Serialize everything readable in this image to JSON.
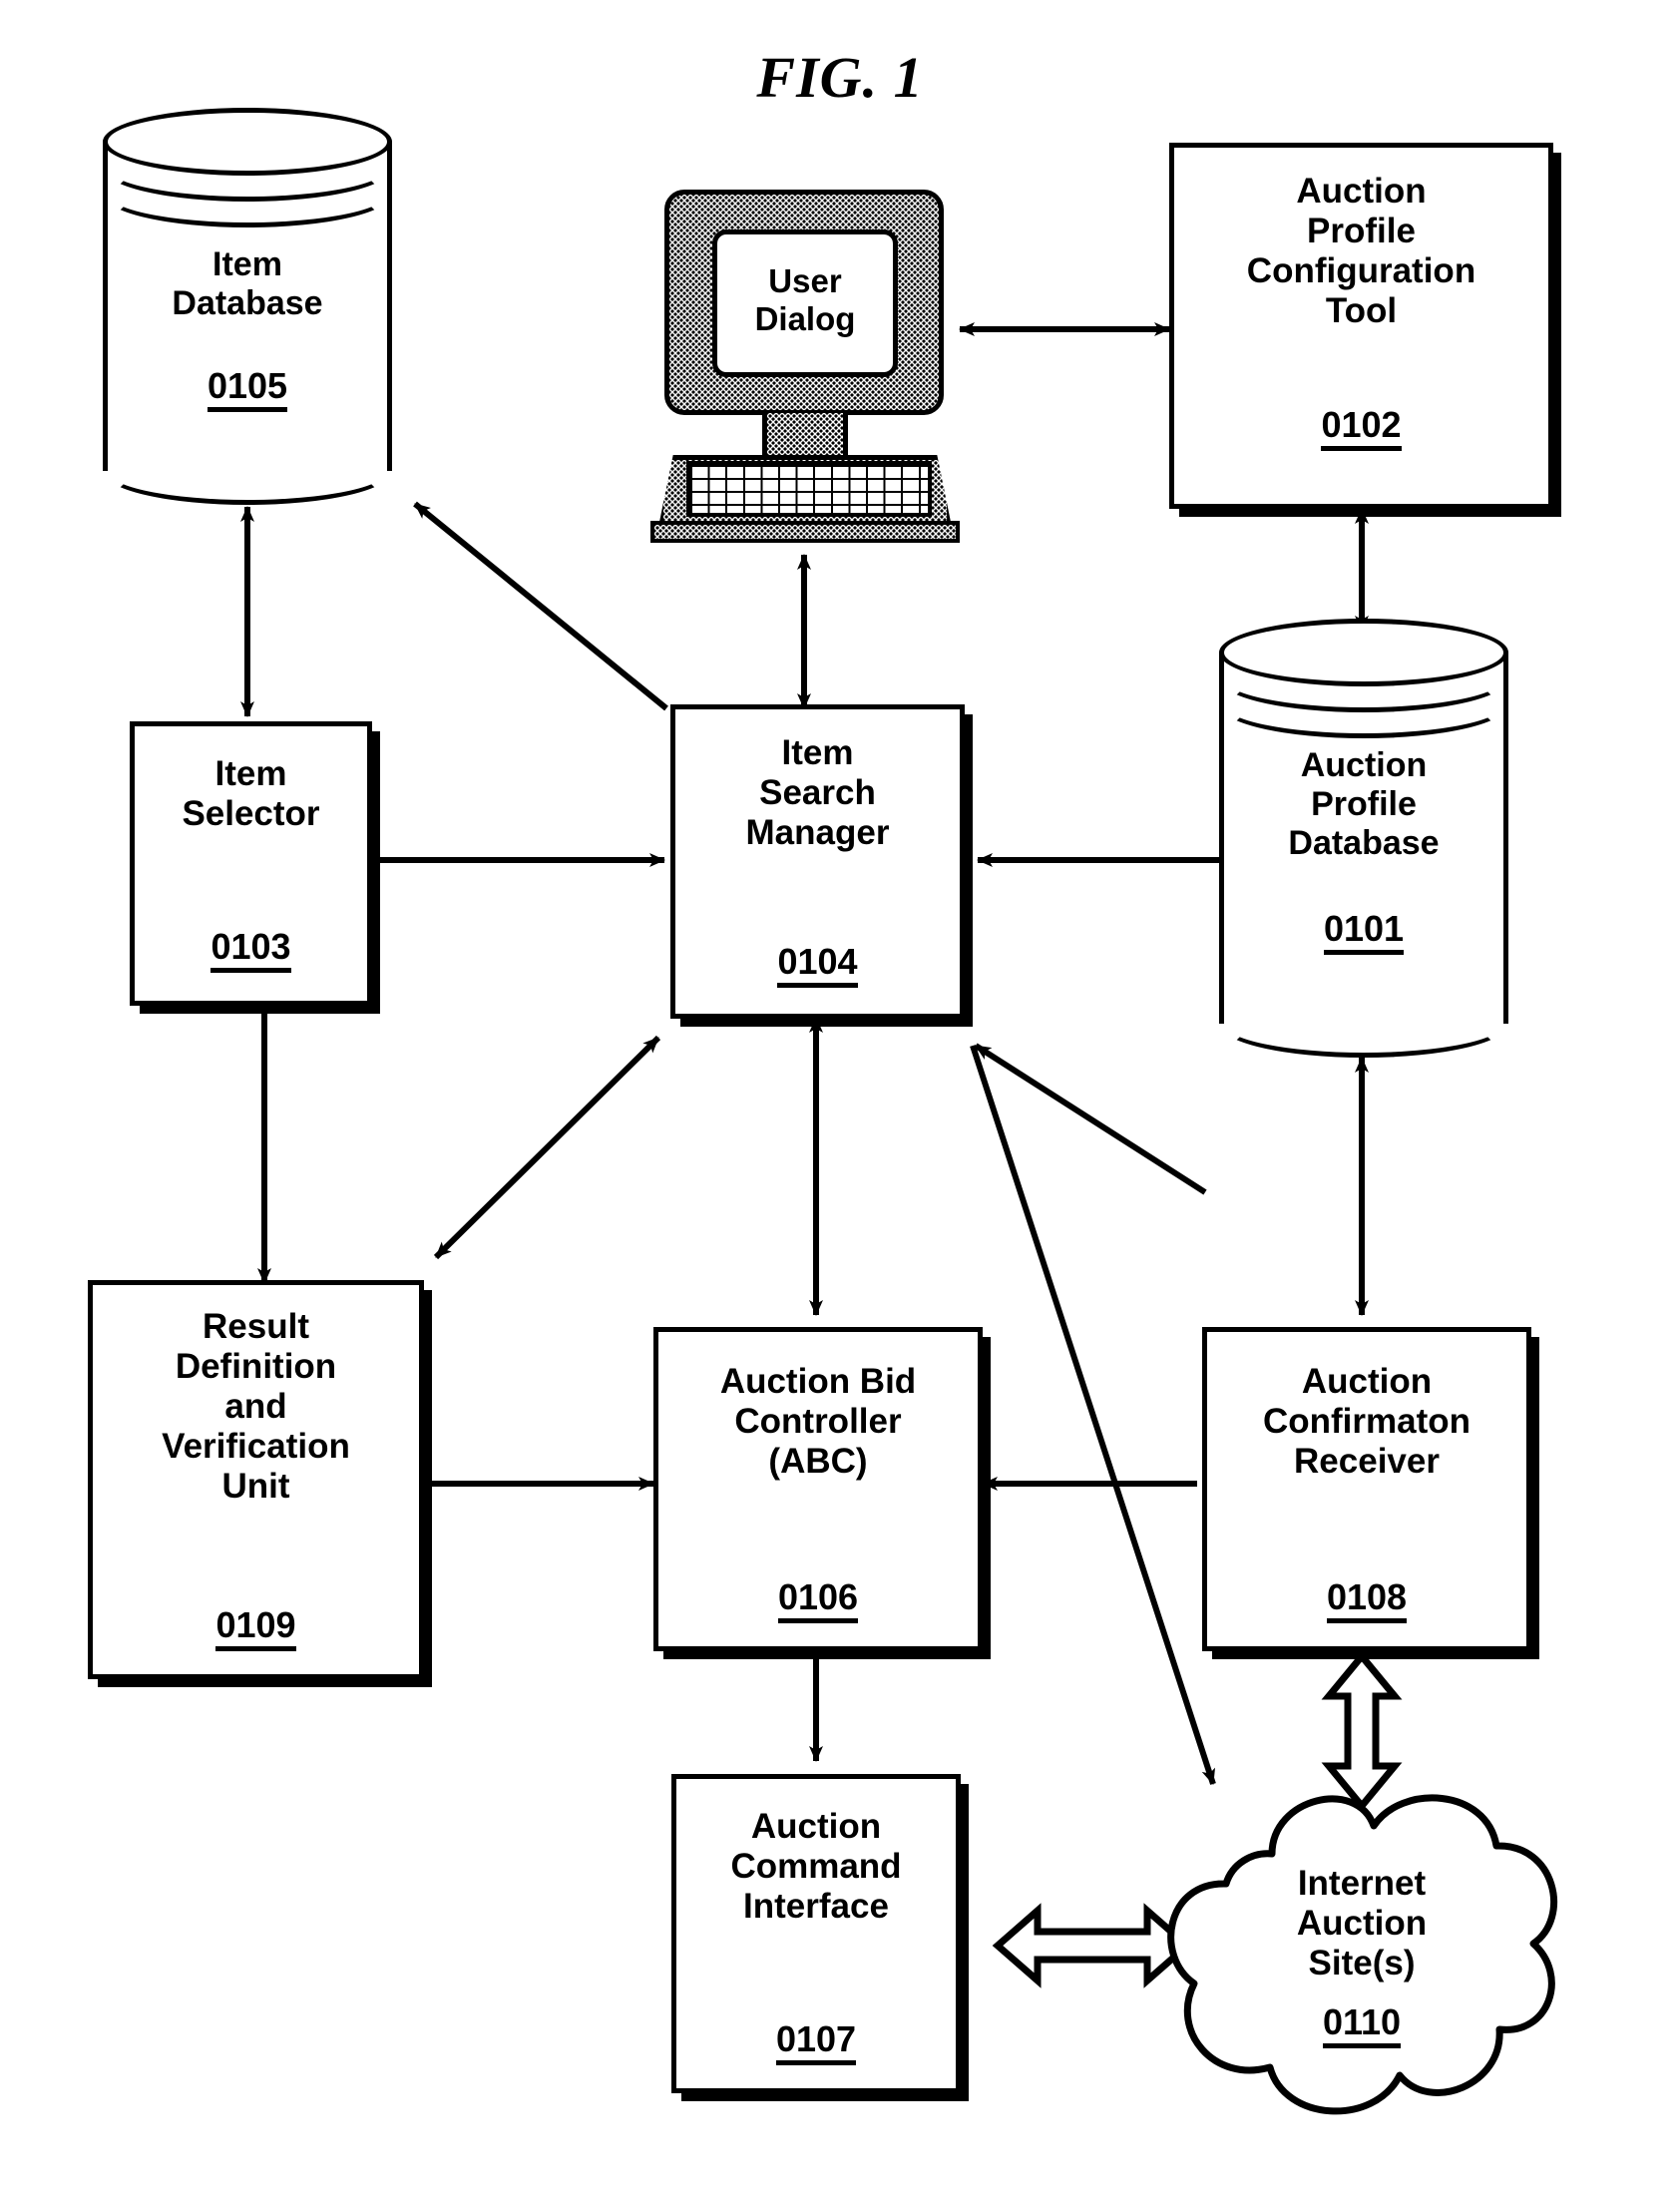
{
  "figure": {
    "title": "FIG. 1",
    "domain_kind": "patent-block-diagram"
  },
  "colors": {
    "ink": "#000000",
    "paper": "#ffffff"
  },
  "nodes": [
    {
      "id": "item_database",
      "shape": "cylinder",
      "label": "Item\nDatabase",
      "ref": "0105"
    },
    {
      "id": "user_dialog",
      "shape": "computer-monitor",
      "label": "User\nDialog",
      "ref": ""
    },
    {
      "id": "auction_profile_configuration_tool",
      "shape": "rectangle",
      "label": "Auction\nProfile\nConfiguration\nTool",
      "ref": "0102"
    },
    {
      "id": "item_selector",
      "shape": "rectangle",
      "label": "Item\nSelector",
      "ref": "0103"
    },
    {
      "id": "item_search_manager",
      "shape": "rectangle",
      "label": "Item\nSearch\nManager",
      "ref": "0104"
    },
    {
      "id": "auction_profile_database",
      "shape": "cylinder",
      "label": "Auction\nProfile\nDatabase",
      "ref": "0101"
    },
    {
      "id": "result_definition_and_verification_unit",
      "shape": "rectangle",
      "label": "Result\nDefinition\nand\nVerification\nUnit",
      "ref": "0109"
    },
    {
      "id": "auction_bid_controller",
      "shape": "rectangle",
      "label": "Auction Bid\nController\n(ABC)",
      "ref": "0106"
    },
    {
      "id": "auction_confirmaton_receiver",
      "shape": "rectangle",
      "label": "Auction\nConfirmaton\nReceiver",
      "ref": "0108"
    },
    {
      "id": "auction_command_interface",
      "shape": "rectangle",
      "label": "Auction\nCommand\nInterface",
      "ref": "0107"
    },
    {
      "id": "internet_auction_sites",
      "shape": "cloud",
      "label": "Internet\nAuction\nSite(s)",
      "ref": "0110"
    }
  ],
  "edges": [
    {
      "from": "user_dialog",
      "to": "auction_profile_configuration_tool",
      "style": "double-arrow-solid"
    },
    {
      "from": "item_database",
      "to": "item_selector",
      "style": "double-arrow-solid"
    },
    {
      "from": "item_search_manager",
      "to": "item_database",
      "style": "single-arrow-solid"
    },
    {
      "from": "user_dialog",
      "to": "item_search_manager",
      "style": "double-arrow-solid"
    },
    {
      "from": "auction_profile_configuration_tool",
      "to": "auction_profile_database",
      "style": "double-arrow-solid"
    },
    {
      "from": "item_selector",
      "to": "item_search_manager",
      "style": "single-arrow-solid"
    },
    {
      "from": "auction_profile_database",
      "to": "item_search_manager",
      "style": "single-arrow-solid"
    },
    {
      "from": "item_selector",
      "to": "result_definition_and_verification_unit",
      "style": "single-arrow-solid"
    },
    {
      "from": "item_search_manager",
      "to": "result_definition_and_verification_unit",
      "style": "double-arrow-solid"
    },
    {
      "from": "item_search_manager",
      "to": "auction_bid_controller",
      "style": "double-arrow-solid"
    },
    {
      "from": "result_definition_and_verification_unit",
      "to": "auction_bid_controller",
      "style": "single-arrow-solid"
    },
    {
      "from": "auction_confirmaton_receiver",
      "to": "auction_bid_controller",
      "style": "single-arrow-solid"
    },
    {
      "from": "auction_profile_database",
      "to": "auction_confirmaton_receiver",
      "style": "double-arrow-solid"
    },
    {
      "from": "auction_confirmaton_receiver",
      "to": "item_search_manager",
      "style": "single-arrow-solid"
    },
    {
      "from": "item_search_manager",
      "to": "internet_auction_sites",
      "style": "single-arrow-solid"
    },
    {
      "from": "auction_bid_controller",
      "to": "auction_command_interface",
      "style": "single-arrow-solid"
    },
    {
      "from": "auction_command_interface",
      "to": "internet_auction_sites",
      "style": "double-arrow-hollow"
    },
    {
      "from": "auction_confirmaton_receiver",
      "to": "internet_auction_sites",
      "style": "double-arrow-hollow"
    }
  ]
}
